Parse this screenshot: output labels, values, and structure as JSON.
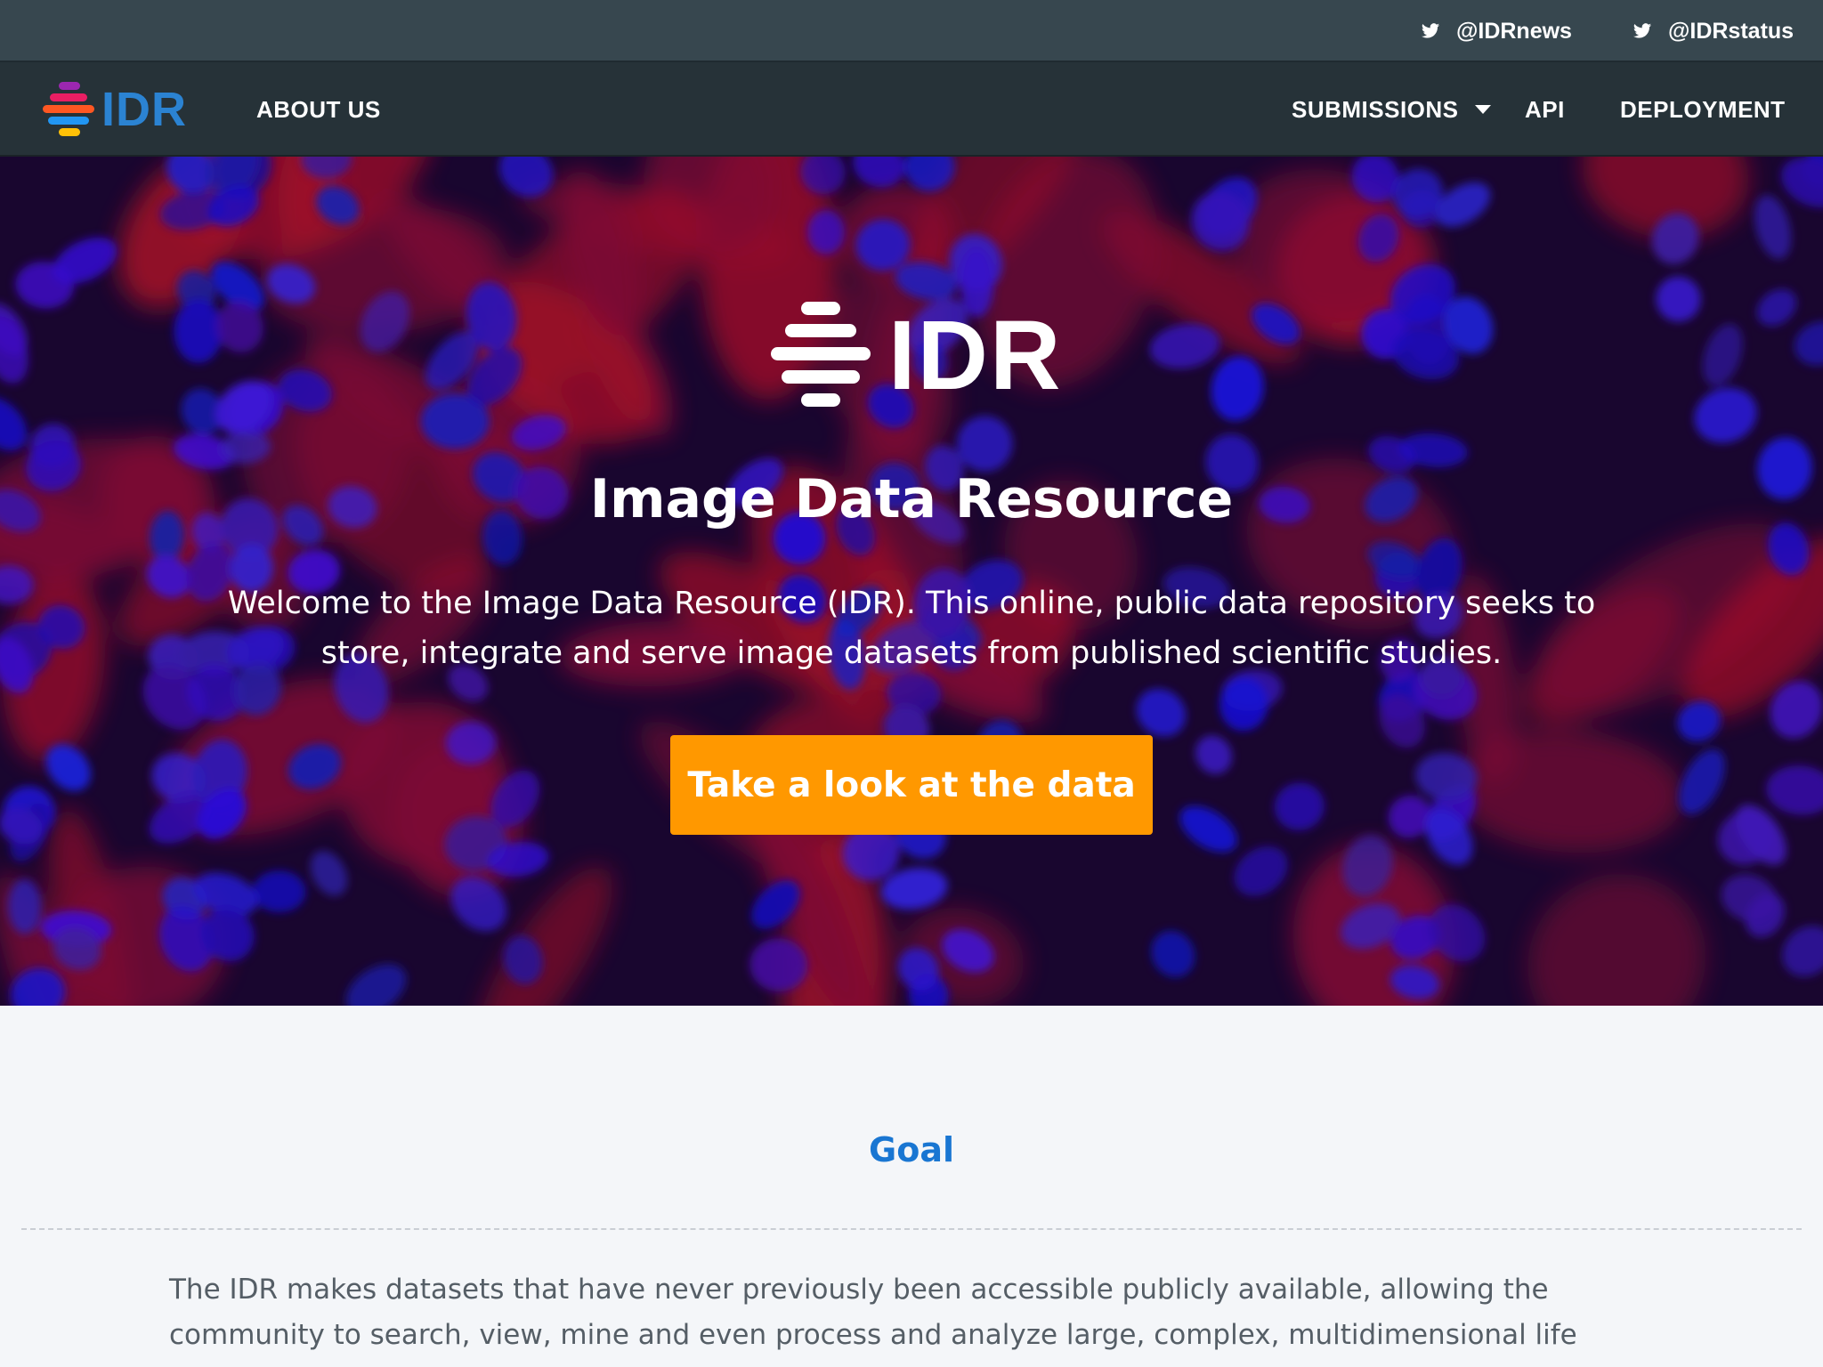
{
  "topbar": {
    "social": [
      {
        "icon": "twitter-icon",
        "label": "@IDRnews"
      },
      {
        "icon": "twitter-icon",
        "label": "@IDRstatus"
      }
    ]
  },
  "navbar": {
    "logo_text": "IDR",
    "about_label": "ABOUT US",
    "submissions_label": "SUBMISSIONS",
    "api_label": "API",
    "deployment_label": "DEPLOYMENT"
  },
  "hero": {
    "logo_text": "IDR",
    "title": "Image Data Resource",
    "description": "Welcome to the Image Data Resource (IDR). This online, public data repository seeks to store, integrate and serve image datasets from published scientific studies.",
    "cta_label": "Take a look at the data"
  },
  "content": {
    "goal_title": "Goal",
    "goal_text": "The IDR makes datasets that have never previously been accessible publicly available, allowing the community to search, view, mine and even process and analyze large, complex, multidimensional life sciences image data."
  },
  "colors": {
    "topbar": "#37474f",
    "navbar": "#263238",
    "brand_blue": "#1976d2",
    "cta_orange": "#ff9800",
    "logo_bars": [
      "#9c27b0",
      "#e91e63",
      "#ff5722",
      "#2196f3",
      "#ffc107"
    ]
  }
}
